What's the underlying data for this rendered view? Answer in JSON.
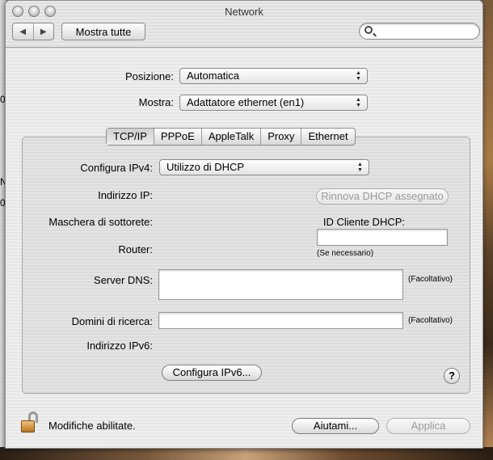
{
  "window": {
    "title": "Network"
  },
  "toolbar": {
    "back_icon": "triangle-left-icon",
    "forward_icon": "triangle-right-icon",
    "show_all_label": "Mostra tutte",
    "search_placeholder": "",
    "search_icon": "magnifier-icon"
  },
  "top": {
    "location_label": "Posizione:",
    "location_value": "Automatica",
    "show_label": "Mostra:",
    "show_value": "Adattatore ethernet (en1)"
  },
  "tabs": [
    {
      "label": "TCP/IP",
      "selected": true
    },
    {
      "label": "PPPoE",
      "selected": false
    },
    {
      "label": "AppleTalk",
      "selected": false
    },
    {
      "label": "Proxy",
      "selected": false
    },
    {
      "label": "Ethernet",
      "selected": false
    }
  ],
  "tcpip": {
    "configure_ipv4_label": "Configura IPv4:",
    "configure_ipv4_value": "Utilizzo di DHCP",
    "ip_label": "Indirizzo IP:",
    "renew_button": "Rinnova DHCP assegnato",
    "subnet_label": "Maschera di sottorete:",
    "dhcp_client_id_label": "ID Cliente DHCP:",
    "dhcp_client_id_value": "",
    "router_label": "Router:",
    "if_needed_note": "(Se necessario)",
    "dns_label": "Server DNS:",
    "dns_value": "",
    "optional_note": "(Facoltativo)",
    "search_domains_label": "Domini di ricerca:",
    "search_domains_value": "",
    "ipv6_label": "Indirizzo IPv6:",
    "configure_ipv6_button": "Configura IPv6...",
    "help_label": "?"
  },
  "footer": {
    "lock_status": "Modifiche abilitate.",
    "help_button": "Aiutami...",
    "apply_button": "Applica"
  },
  "desktop": {
    "edge_glyphs": [
      "0",
      "N",
      "0"
    ]
  }
}
